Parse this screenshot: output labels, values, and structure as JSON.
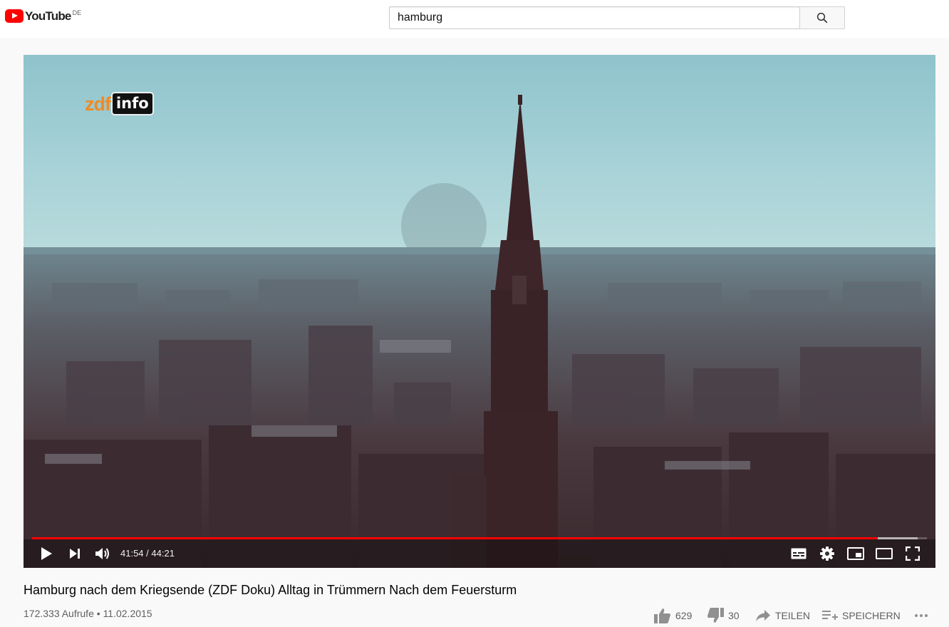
{
  "header": {
    "logo_text": "YouTube",
    "country_code": "DE",
    "search_value": "hamburg",
    "search_icon": "search-icon"
  },
  "player": {
    "watermark_zdf": "zdf",
    "watermark_info": "info",
    "current_time": "41:54",
    "duration": "44:21",
    "time_separator": " / ",
    "progress_played_fraction": 0.9447,
    "progress_loaded_fraction": 0.99,
    "colors": {
      "played": "#ff0000"
    },
    "icons": [
      "play-icon",
      "next-icon",
      "volume-icon",
      "subtitles-icon",
      "settings-icon",
      "miniplayer-icon",
      "theater-mode-icon",
      "fullscreen-icon"
    ]
  },
  "video": {
    "title": "Hamburg nach dem Kriegsende (ZDF Doku) Alltag in Trümmern Nach dem Feuersturm",
    "views": "172.333 Aufrufe",
    "separator": " • ",
    "date": "11.02.2015"
  },
  "actions": {
    "likes": "629",
    "dislikes": "30",
    "share_label": "TEILEN",
    "save_label": "SPEICHERN",
    "icons": [
      "thumbs-up-icon",
      "thumbs-down-icon",
      "share-icon",
      "add-to-playlist-icon",
      "more-icon"
    ]
  }
}
